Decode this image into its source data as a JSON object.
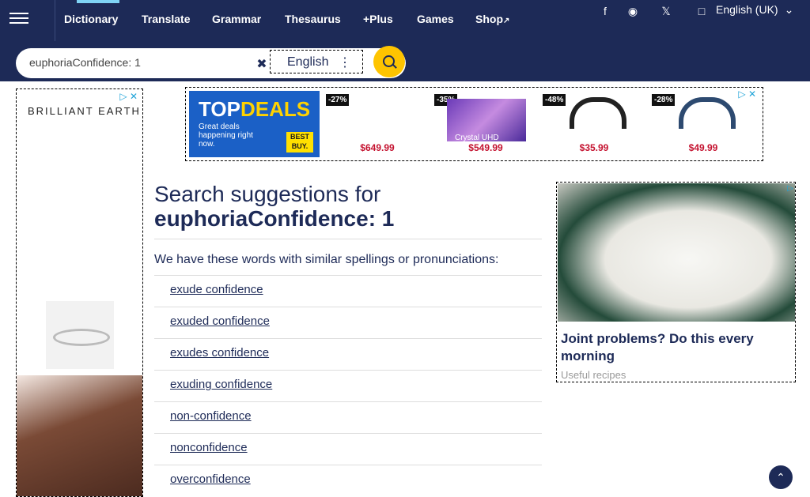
{
  "nav": {
    "items": [
      "Dictionary",
      "Translate",
      "Grammar",
      "Thesaurus",
      "+Plus",
      "Games",
      "Shop"
    ],
    "shop_icon": "external-link-icon",
    "language": "English (UK)"
  },
  "search": {
    "value": "euphoriaConfidence: 1",
    "language": "English"
  },
  "left_ad": {
    "brand": "BRILLIANT EARTH"
  },
  "deals_ad": {
    "title_a": "TOP",
    "title_b": "DEALS",
    "subtitle": "Great deals happening right now.",
    "bestbuy": "BEST BUY.",
    "products": [
      {
        "discount": "-27%",
        "price": "$649.99"
      },
      {
        "discount": "-35%",
        "price": "$549.99",
        "caption": "Crystal UHD"
      },
      {
        "discount": "-48%",
        "price": "$35.99"
      },
      {
        "discount": "-28%",
        "price": "$49.99"
      }
    ]
  },
  "main": {
    "heading_prefix": "Search suggestions for",
    "heading_term": "euphoriaConfidence: 1",
    "intro": "We have these words with similar spellings or pronunciations:",
    "suggestions": [
      "exude confidence",
      "exuded confidence",
      "exudes confidence",
      "exuding confidence",
      "non-confidence",
      "nonconfidence",
      "overconfidence"
    ]
  },
  "right_ad": {
    "title": "Joint problems? Do this every morning",
    "source": "Useful recipes"
  },
  "colors": {
    "navy": "#1d2a57",
    "yellow": "#fec400",
    "accent": "#7fd3f5"
  }
}
